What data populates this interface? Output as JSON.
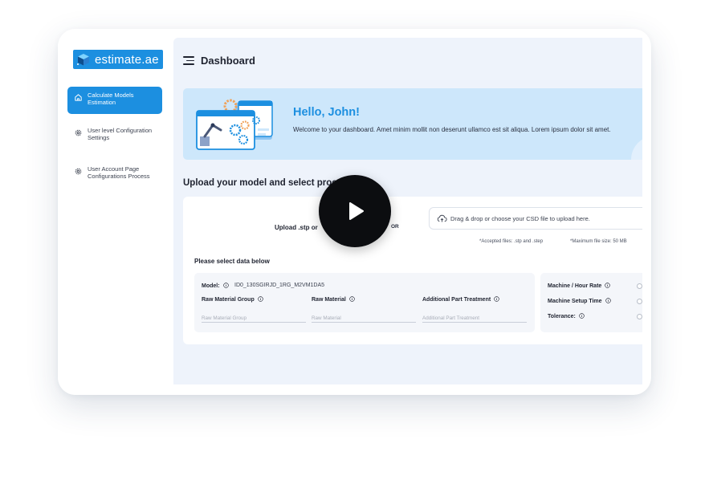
{
  "app": {
    "logo_text": "estimate.ae",
    "brand_color": "#1c8fe0"
  },
  "sidebar": {
    "items": [
      {
        "label": "Calculate Models Estimation",
        "icon": "home-icon",
        "active": true
      },
      {
        "label": "User level Configuration Settings",
        "icon": "gear-icon",
        "active": false
      },
      {
        "label": "User Account Page Configurations Process",
        "icon": "gear-icon",
        "active": false
      }
    ]
  },
  "header": {
    "title": "Dashboard",
    "menu_icon": "hamburger-menu-icon"
  },
  "welcome": {
    "greeting": "Hello, John!",
    "message": "Welcome to your dashboard. Amet minim mollit non deserunt ullamco est sit aliqua. Lorem ipsum dolor sit amet.",
    "background_color": "#cde7fb"
  },
  "upload_section": {
    "title": "Upload your model and select proc",
    "upload_label": "Upload .stp or",
    "or_label": "OR",
    "drop_text": "Drag & drop or choose your CSD file to upload here.",
    "accepted_files": "*Accepted files: .stp  and .step",
    "max_size": "*Maximum file size: 50 MB",
    "select_title": "Please select data below"
  },
  "form": {
    "model_label": "Model:",
    "model_value": "ID0_130SGIRJD_1RG_M2VM1DA5",
    "raw_material_group_label": "Raw Material Group",
    "raw_material_group_placeholder": "Raw Material Group",
    "raw_material_label": "Raw Material",
    "raw_material_placeholder": "Raw Material",
    "additional_treatment_label": "Additional Part Treatment",
    "additional_treatment_placeholder": "Additional Part Treatment",
    "machine_hour_rate_label": "Machine / Hour Rate",
    "machine_setup_time_label": "Machine Setup Time",
    "tolerance_label": "Tolerance:"
  },
  "video": {
    "play_icon": "play-icon"
  }
}
